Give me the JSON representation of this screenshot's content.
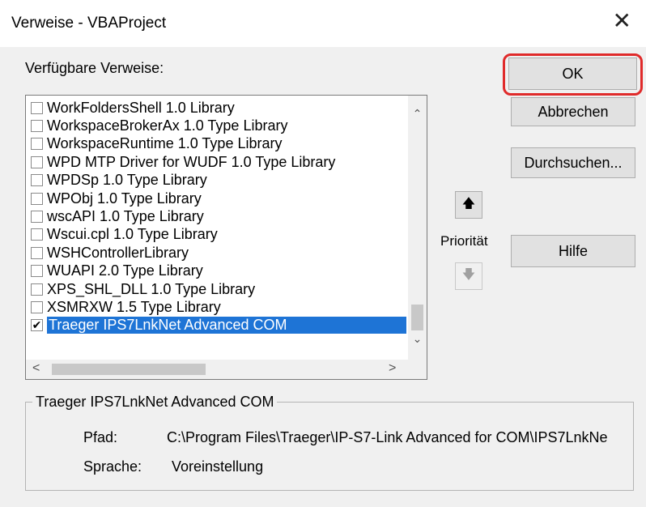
{
  "window": {
    "title": "Verweise - VBAProject",
    "close_glyph": "✕"
  },
  "references": {
    "label": "Verfügbare Verweise:",
    "items": [
      {
        "label": "WorkFoldersShell 1.0 Library",
        "checked": false
      },
      {
        "label": "WorkspaceBrokerAx 1.0 Type Library",
        "checked": false
      },
      {
        "label": "WorkspaceRuntime 1.0 Type Library",
        "checked": false
      },
      {
        "label": "WPD MTP Driver for WUDF 1.0 Type Library",
        "checked": false
      },
      {
        "label": "WPDSp 1.0 Type Library",
        "checked": false
      },
      {
        "label": "WPObj 1.0 Type Library",
        "checked": false
      },
      {
        "label": "wscAPI 1.0 Type Library",
        "checked": false
      },
      {
        "label": "Wscui.cpl 1.0 Type Library",
        "checked": false
      },
      {
        "label": "WSHControllerLibrary",
        "checked": false
      },
      {
        "label": "WUAPI 2.0 Type Library",
        "checked": false
      },
      {
        "label": "XPS_SHL_DLL 1.0 Type Library",
        "checked": false
      },
      {
        "label": "XSMRXW 1.5 Type Library",
        "checked": false
      },
      {
        "label": "Traeger IPS7LnkNet Advanced COM",
        "checked": true,
        "selected": true
      }
    ],
    "check_glyph": "✔"
  },
  "buttons": {
    "ok": "OK",
    "cancel": "Abbrechen",
    "browse": "Durchsuchen...",
    "help": "Hilfe"
  },
  "priority": {
    "label": "Priorität",
    "up_glyph": "🡅",
    "down_glyph": "🡇"
  },
  "scroll": {
    "up": "⌃",
    "down": "⌄",
    "left": "<",
    "right": ">"
  },
  "details": {
    "title": "Traeger IPS7LnkNet Advanced COM",
    "path_label": "Pfad:",
    "path_value": "C:\\Program Files\\Traeger\\IP-S7-Link Advanced for COM\\IPS7LnkNe",
    "language_label": "Sprache:",
    "language_value": "Voreinstellung"
  },
  "colors": {
    "selection": "#1e74d6",
    "highlight_ring": "#e02a2a"
  }
}
